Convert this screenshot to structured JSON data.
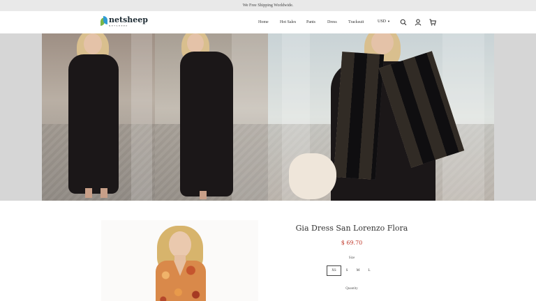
{
  "announcement": "We Free Shipping Worldwide.",
  "brand": {
    "name": "netsheep",
    "tagline": "NETSHEEP"
  },
  "nav": {
    "items": [
      "Home",
      "Hot Sales",
      "Pants",
      "Dress",
      "Tracksuit"
    ],
    "currency": "USD"
  },
  "icons": {
    "search": "search-icon",
    "account": "user-icon",
    "cart": "cart-icon",
    "currency_caret": "caret-down-icon"
  },
  "product": {
    "title": "Gia Dress San Lorenzo Flora",
    "price": "$ 69.70",
    "size_label": "Size",
    "sizes": [
      "XS",
      "S",
      "M",
      "L"
    ],
    "selected_size": "XS",
    "quantity_label": "Quantity"
  },
  "colors": {
    "price": "#c0392b",
    "announce_bg": "#e9e9e9"
  }
}
